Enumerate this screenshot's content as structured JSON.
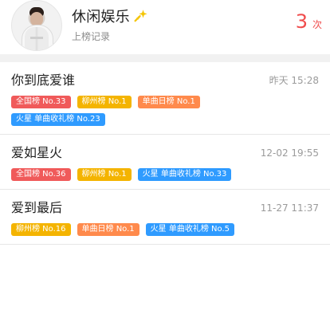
{
  "header": {
    "name": "休闲娱乐",
    "subtitle": "上榜记录",
    "count": "3",
    "count_unit": "次"
  },
  "colors": {
    "red": "#f05a5a",
    "yellow": "#f4b400",
    "orange": "#ff8a4c",
    "blue": "#2f9bff",
    "count": "#f04c4c"
  },
  "records": [
    {
      "title": "你到底爱谁",
      "time": "昨天 15:28",
      "tags": [
        {
          "label": "全国榜 No.33",
          "color": "red"
        },
        {
          "label": "柳州榜 No.1",
          "color": "yellow"
        },
        {
          "label": "单曲日榜 No.1",
          "color": "orange"
        },
        {
          "label": "火星 单曲收礼榜 No.23",
          "color": "blue"
        }
      ]
    },
    {
      "title": "爱如星火",
      "time": "12-02 19:55",
      "tags": [
        {
          "label": "全国榜 No.36",
          "color": "red"
        },
        {
          "label": "柳州榜 No.1",
          "color": "yellow"
        },
        {
          "label": "火星 单曲收礼榜 No.33",
          "color": "blue"
        }
      ]
    },
    {
      "title": "爱到最后",
      "time": "11-27 11:37",
      "tags": [
        {
          "label": "柳州榜 No.16",
          "color": "yellow"
        },
        {
          "label": "单曲日榜 No.1",
          "color": "orange"
        },
        {
          "label": "火星 单曲收礼榜 No.5",
          "color": "blue"
        }
      ]
    }
  ]
}
